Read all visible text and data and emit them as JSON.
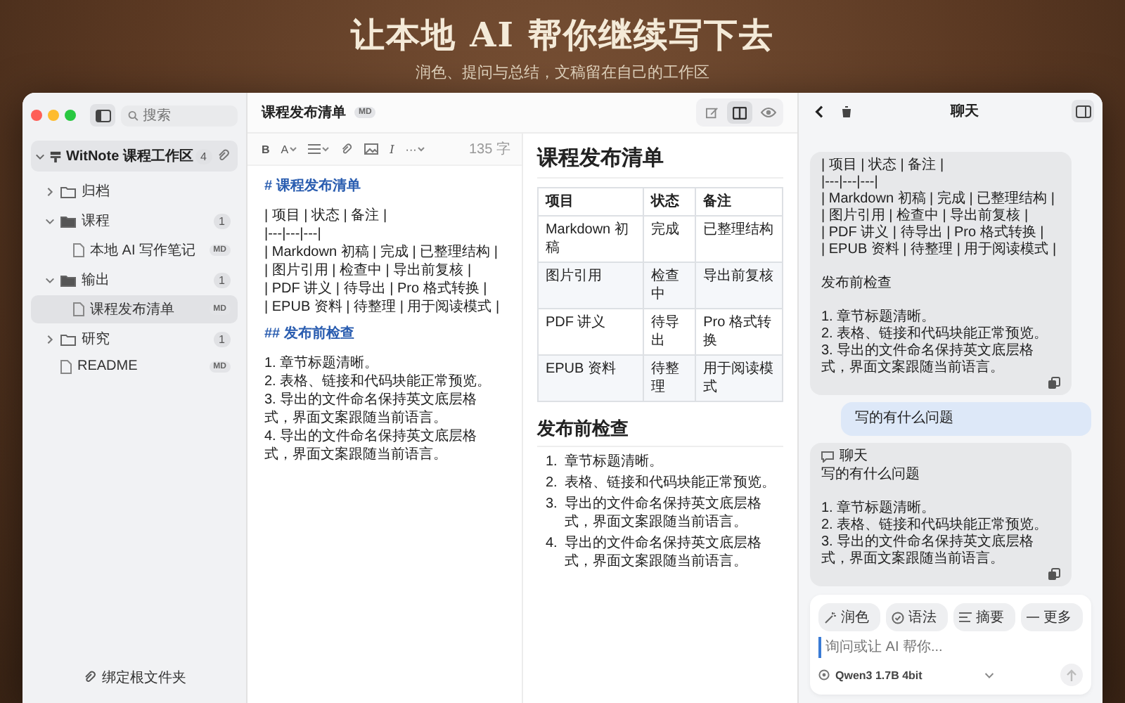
{
  "hero": {
    "title": "让本地 AI 帮你继续写下去",
    "subtitle": "润色、提问与总结，文稿留在自己的工作区"
  },
  "sidebar": {
    "search": {
      "placeholder": "搜索"
    },
    "workspace": {
      "name": "WitNote 课程工作区",
      "count": "4",
      "expanded": true
    },
    "tree": [
      {
        "kind": "folder",
        "label": "归档",
        "expanded": false,
        "selected": false
      },
      {
        "kind": "folder",
        "label": "课程",
        "count": "1",
        "expanded": true,
        "selected": false,
        "children": [
          {
            "kind": "file",
            "label": "本地 AI 写作笔记",
            "badge": "MD",
            "selected": false
          }
        ]
      },
      {
        "kind": "folder",
        "label": "输出",
        "count": "1",
        "expanded": true,
        "selected": false,
        "children": [
          {
            "kind": "file",
            "label": "课程发布清单",
            "badge": "MD",
            "selected": true
          }
        ]
      },
      {
        "kind": "folder",
        "label": "研究",
        "count": "1",
        "expanded": false,
        "selected": false
      },
      {
        "kind": "file",
        "label": "README",
        "badge": "MD",
        "selected": false
      }
    ],
    "footer_button": "绑定根文件夹"
  },
  "document": {
    "title": "课程发布清单",
    "badge": "MD",
    "view_modes": [
      {
        "kind": "edit",
        "selected": false
      },
      {
        "kind": "split",
        "selected": true
      },
      {
        "kind": "preview",
        "selected": false
      }
    ]
  },
  "editor": {
    "toolbar": [
      {
        "kind": "bold",
        "label": "B"
      },
      {
        "kind": "font",
        "label": "A"
      },
      {
        "kind": "list"
      },
      {
        "kind": "link"
      },
      {
        "kind": "image"
      },
      {
        "kind": "italic",
        "label": "I"
      },
      {
        "kind": "more",
        "label": "···"
      }
    ],
    "word_count": "135 字",
    "lines": [
      {
        "kind": "heading",
        "text": "# 课程发布清单"
      },
      {
        "kind": "text",
        "text": "| 项目 | 状态 | 备注 |"
      },
      {
        "kind": "text",
        "text": "|---|---|---|"
      },
      {
        "kind": "text",
        "text": "| Markdown 初稿 | 完成 | 已整理结构 |"
      },
      {
        "kind": "text",
        "text": "| 图片引用 | 检查中 | 导出前复核 |"
      },
      {
        "kind": "text",
        "text": "| PDF 讲义 | 待导出 | Pro 格式转换 |"
      },
      {
        "kind": "text",
        "text": "| EPUB 资料 | 待整理 | 用于阅读模式 |"
      },
      {
        "kind": "heading",
        "text": "## 发布前检查"
      },
      {
        "kind": "text",
        "text": "1. 章节标题清晰。"
      },
      {
        "kind": "text",
        "text": "2. 表格、链接和代码块能正常预览。"
      },
      {
        "kind": "text",
        "text": "3. 导出的文件命名保持英文底层格式，界面文案跟随当前语言。"
      },
      {
        "kind": "text",
        "text": "4. 导出的文件命名保持英文底层格式，界面文案跟随当前语言。"
      }
    ]
  },
  "preview": {
    "title": "课程发布清单",
    "table": {
      "columns": [
        "项目",
        "状态",
        "备注"
      ],
      "rows": [
        [
          "Markdown 初稿",
          "完成",
          "已整理结构"
        ],
        [
          "图片引用",
          "检查中",
          "导出前复核"
        ],
        [
          "PDF 讲义",
          "待导出",
          "Pro 格式转换"
        ],
        [
          "EPUB 资料",
          "待整理",
          "用于阅读模式"
        ]
      ]
    },
    "section_title": "发布前检查",
    "items": [
      {
        "number": "1.",
        "text": "章节标题清晰。"
      },
      {
        "number": "2.",
        "text": "表格、链接和代码块能正常预览。"
      },
      {
        "number": "3.",
        "text": "导出的文件命名保持英文底层格式，界面文案跟随当前语言。"
      },
      {
        "number": "4.",
        "text": "导出的文件命名保持英文底层格式，界面文案跟随当前语言。"
      }
    ]
  },
  "chat": {
    "title": "聊天",
    "messages": [
      {
        "kind": "assistant",
        "text": "| 项目 | 状态 | 备注 |\n|---|---|---|\n| Markdown 初稿 | 完成 | 已整理结构 |\n| 图片引用 | 检查中 | 导出前复核 |\n| PDF 讲义 | 待导出 | Pro 格式转换 |\n| EPUB 资料 | 待整理 | 用于阅读模式 |\n\n发布前检查\n\n1. 章节标题清晰。\n2. 表格、链接和代码块能正常预览。\n3. 导出的文件命名保持英文底层格式，界面文案跟随当前语言。"
      },
      {
        "kind": "user",
        "text": "写的有什么问题"
      },
      {
        "kind": "assistant",
        "label": "聊天",
        "text": "写的有什么问题\n\n1. 章节标题清晰。\n2. 表格、链接和代码块能正常预览。\n3. 导出的文件命名保持英文底层格式，界面文案跟随当前语言。"
      }
    ],
    "actions": [
      {
        "kind": "polish",
        "label": "润色"
      },
      {
        "kind": "grammar",
        "label": "语法"
      },
      {
        "kind": "summary",
        "label": "摘要"
      },
      {
        "kind": "more",
        "label": "更多"
      }
    ],
    "input": {
      "placeholder": "询问或让 AI 帮你..."
    },
    "model": "Qwen3 1.7B 4bit"
  }
}
